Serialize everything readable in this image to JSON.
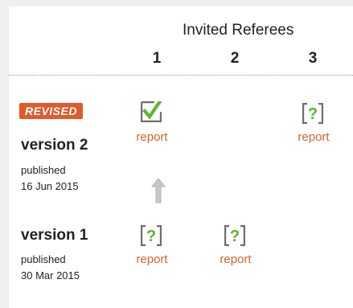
{
  "header": {
    "title": "Invited Referees",
    "columns": [
      "1",
      "2",
      "3"
    ]
  },
  "versions": [
    {
      "badge": "REVISED",
      "title": "version 2",
      "status_label": "published",
      "date": "16 Jun 2015",
      "reports": [
        {
          "referee": "1",
          "status": "approved",
          "icon": "checkmark-icon",
          "label": "report"
        },
        {
          "referee": "3",
          "status": "approved-with-reservations",
          "icon": "question-icon",
          "label": "report"
        }
      ]
    },
    {
      "title": "version 1",
      "status_label": "published",
      "date": "30 Mar 2015",
      "reports": [
        {
          "referee": "1",
          "status": "approved-with-reservations",
          "icon": "question-icon",
          "label": "report"
        },
        {
          "referee": "2",
          "status": "approved-with-reservations",
          "icon": "question-icon",
          "label": "report"
        }
      ]
    }
  ],
  "colors": {
    "accent_green": "#5cb531",
    "icon_frame": "#6e6e6e",
    "link_orange": "#d4632e",
    "badge_bg": "#e05a2b",
    "arrow_gray": "#c6c6c6"
  }
}
